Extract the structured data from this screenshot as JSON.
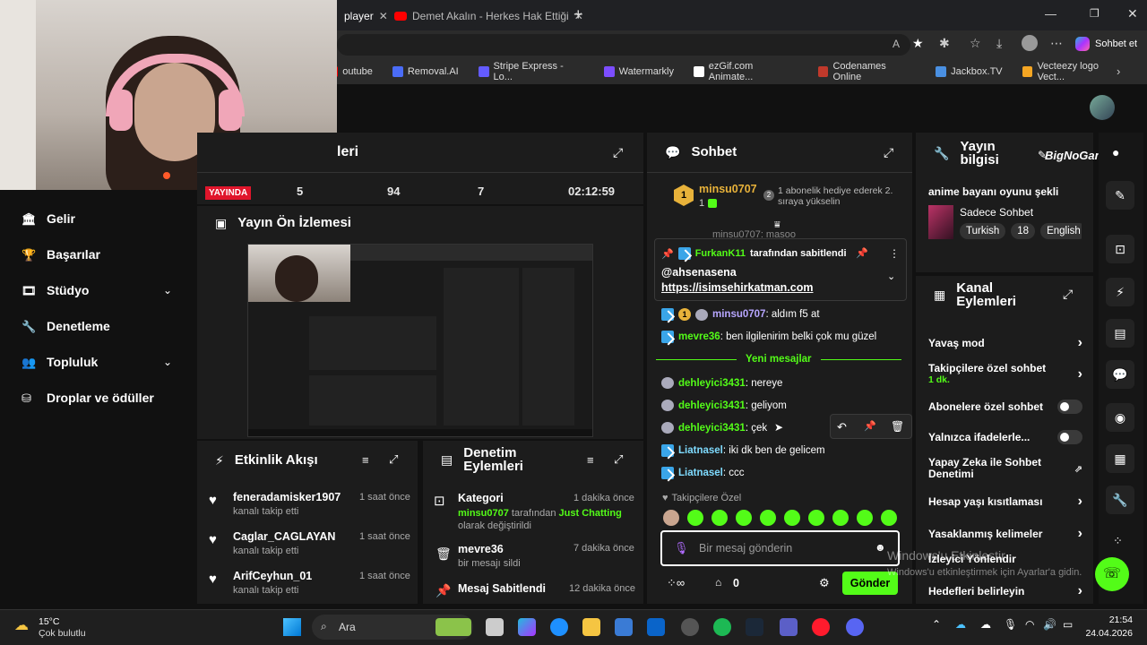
{
  "browser": {
    "tabs": [
      {
        "label": "player"
      },
      {
        "label": "Demet Akalın - Herkes Hak Ettiği"
      }
    ],
    "new_tab": "+",
    "copilot_label": "Sohbet et",
    "bookmarks": [
      {
        "label": "outube",
        "color": "#ff0000"
      },
      {
        "label": "Removal.AI",
        "color": "#4a6cf7"
      },
      {
        "label": "Stripe Express - Lo...",
        "color": "#635bff"
      },
      {
        "label": "Watermarkly",
        "color": "#7c4dff"
      },
      {
        "label": "ezGif.com Animate...",
        "color": "#ffffff"
      },
      {
        "label": "Codenames Online",
        "color": "#c0392b"
      },
      {
        "label": "Jackbox.TV",
        "color": "#4a90e2"
      },
      {
        "label": "Vecteezy logo Vect...",
        "color": "#f5a623"
      }
    ]
  },
  "sidebar": {
    "items": [
      {
        "label": "Gelir",
        "icon": "bank-icon",
        "glyph": "🏛"
      },
      {
        "label": "Başarılar",
        "icon": "trophy-icon",
        "glyph": "🏆"
      },
      {
        "label": "Stüdyo",
        "icon": "film-icon",
        "glyph": "🎞"
      },
      {
        "label": "Denetleme",
        "icon": "wrench-icon",
        "glyph": "🔧"
      },
      {
        "label": "Topluluk",
        "icon": "people-icon",
        "glyph": "👥"
      },
      {
        "label": "Droplar ve ödüller",
        "icon": "gift-icon",
        "glyph": "⛁"
      }
    ]
  },
  "stats": {
    "title_partial": "leri",
    "live_badge": "YAYINDA",
    "values": [
      "5",
      "94",
      "7",
      "02:12:59"
    ]
  },
  "preview": {
    "title": "Yayın Ön İzlemesi"
  },
  "activity": {
    "title": "Etkinlik Akışı",
    "items": [
      {
        "name": "feneradamisker1907",
        "sub": "kanalı takip etti",
        "time": "1 saat önce"
      },
      {
        "name": "Caglar_CAGLAYAN",
        "sub": "kanalı takip etti",
        "time": "1 saat önce"
      },
      {
        "name": "ArifCeyhun_01",
        "sub": "kanalı takip etti",
        "time": "1 saat önce"
      }
    ]
  },
  "moderation": {
    "title": "Denetim Eylemleri",
    "items": [
      {
        "title": "Kategori",
        "time": "1 dakika önce",
        "user": "minsu0707",
        "mid": " tarafından ",
        "cat": "Just Chatting",
        "rest": "olarak değiştirildi"
      },
      {
        "title": "mevre36",
        "time": "7 dakika önce",
        "sub": "bir mesajı sildi"
      },
      {
        "title": "Mesaj Sabitlendi",
        "time": "12 dakika önce"
      }
    ]
  },
  "chat": {
    "title": "Sohbet",
    "top_user": "minsu0707",
    "top_count": "1",
    "gift_text": "1 abonelik hediye ederek 2. sıraya yükselin",
    "gift_rank": "2",
    "partial_line": "minsu0707: masoo",
    "pinned_by": "FurkanK11",
    "pinned_suffix": " tarafından sabitlendi",
    "pinned_mention": "@ahsenasena",
    "pinned_link": "https://isimsehirkatman.com",
    "new_messages": "Yeni mesajlar",
    "messages": [
      {
        "user": "minsu0707",
        "text": ": aldım f5 at",
        "style": "p"
      },
      {
        "user": "mevre36",
        "text": ": ben ilgilenirim belki çok mu güzel",
        "style": "g"
      },
      {
        "user": "dehleyici3431",
        "text": ": nereye",
        "style": "g"
      },
      {
        "user": "dehleyici3431",
        "text": ": geliyom",
        "style": "g"
      },
      {
        "user": "dehleyici3431",
        "text": ": çek",
        "style": "g"
      },
      {
        "user": "Liatnasel",
        "text": ": iki dk ben de gelicem",
        "style": "c"
      },
      {
        "user": "Liatnasel",
        "text": ": ccc",
        "style": "c"
      }
    ],
    "followers_only": "Takipçilere Özel",
    "input_placeholder": "Bir mesaj gönderin",
    "points": "0",
    "send": "Gönder"
  },
  "stream_info": {
    "title": "Yayın bilgisi",
    "stream_title": "anime bayanı oyunu şekli",
    "category": "Sadece Sohbet",
    "tags": [
      "Turkish",
      "18",
      "English"
    ],
    "brand": "BigNoGame"
  },
  "channel_actions": {
    "title": "Kanal Eylemleri",
    "rows": [
      {
        "label": "Yavaş mod",
        "control": "chevron"
      },
      {
        "label": "Takipçilere özel sohbet",
        "sub": "1 dk.",
        "control": "chevron"
      },
      {
        "label": "Abonelere özel sohbet",
        "control": "toggle"
      },
      {
        "label": "Yalnızca ifadelerle...",
        "control": "toggle"
      },
      {
        "label": "Yapay Zeka ile Sohbet Denetimi",
        "control": "external"
      },
      {
        "label": "Hesap yaşı kısıtlaması",
        "control": "chevron"
      },
      {
        "label": "Yasaklanmış kelimeler",
        "control": "chevron"
      },
      {
        "label": "İzleyici Yönlendir",
        "control": "none"
      },
      {
        "label": "Hedefleri belirleyin",
        "control": "chevron"
      }
    ]
  },
  "watermark": {
    "line1": "Windows'u Etkinleştir",
    "line2": "Windows'u etkinleştirmek için Ayarlar'a gidin."
  },
  "taskbar": {
    "temp": "15°C",
    "weather": "Çok bulutlu",
    "search": "Ara",
    "time": "21:54",
    "date": "24.04.2026"
  },
  "colors": {
    "accent": "#53fc18",
    "live": "#e0152b",
    "panel": "#1c1c1c"
  }
}
